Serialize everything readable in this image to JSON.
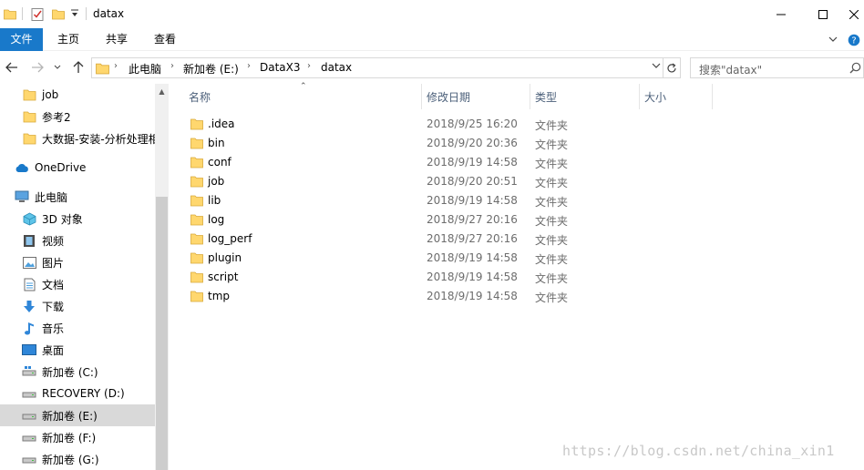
{
  "window": {
    "title": "datax",
    "colors": {
      "accent": "#1979ca",
      "folder": "#ffd76e",
      "selected_row": "#d9d9d9"
    }
  },
  "ribbon": {
    "tabs": [
      {
        "label": "文件"
      },
      {
        "label": "主页"
      },
      {
        "label": "共享"
      },
      {
        "label": "查看"
      }
    ]
  },
  "address": {
    "crumbs": [
      "此电脑",
      "新加卷 (E:)",
      "DataX3",
      "datax"
    ]
  },
  "search": {
    "placeholder": "搜索\"datax\""
  },
  "nav": {
    "items": [
      {
        "label": "job",
        "icon": "folder-icon"
      },
      {
        "label": "参考2",
        "icon": "folder-icon"
      },
      {
        "label": "大数据-安装-分析处理相",
        "icon": "folder-icon"
      },
      {
        "label": "OneDrive",
        "icon": "cloud-icon"
      },
      {
        "label": "此电脑",
        "icon": "computer-icon"
      },
      {
        "label": "3D 对象",
        "icon": "cube-icon"
      },
      {
        "label": "视频",
        "icon": "video-icon"
      },
      {
        "label": "图片",
        "icon": "picture-icon"
      },
      {
        "label": "文档",
        "icon": "document-icon"
      },
      {
        "label": "下载",
        "icon": "download-icon"
      },
      {
        "label": "音乐",
        "icon": "music-icon"
      },
      {
        "label": "桌面",
        "icon": "desktop-icon"
      },
      {
        "label": "新加卷 (C:)",
        "icon": "drive-icon"
      },
      {
        "label": "RECOVERY (D:)",
        "icon": "drive-icon"
      },
      {
        "label": "新加卷 (E:)",
        "icon": "drive-icon",
        "selected": true
      },
      {
        "label": "新加卷 (F:)",
        "icon": "drive-icon"
      },
      {
        "label": "新加卷 (G:)",
        "icon": "drive-icon"
      }
    ]
  },
  "columns": {
    "name": "名称",
    "date": "修改日期",
    "type": "类型",
    "size": "大小"
  },
  "files": [
    {
      "name": ".idea",
      "date": "2018/9/25 16:20",
      "type": "文件夹"
    },
    {
      "name": "bin",
      "date": "2018/9/20 20:36",
      "type": "文件夹"
    },
    {
      "name": "conf",
      "date": "2018/9/19 14:58",
      "type": "文件夹"
    },
    {
      "name": "job",
      "date": "2018/9/20 20:51",
      "type": "文件夹"
    },
    {
      "name": "lib",
      "date": "2018/9/19 14:58",
      "type": "文件夹"
    },
    {
      "name": "log",
      "date": "2018/9/27 20:16",
      "type": "文件夹"
    },
    {
      "name": "log_perf",
      "date": "2018/9/27 20:16",
      "type": "文件夹"
    },
    {
      "name": "plugin",
      "date": "2018/9/19 14:58",
      "type": "文件夹"
    },
    {
      "name": "script",
      "date": "2018/9/19 14:58",
      "type": "文件夹"
    },
    {
      "name": "tmp",
      "date": "2018/9/19 14:58",
      "type": "文件夹"
    }
  ],
  "watermark": "https://blog.csdn.net/china_xin1"
}
